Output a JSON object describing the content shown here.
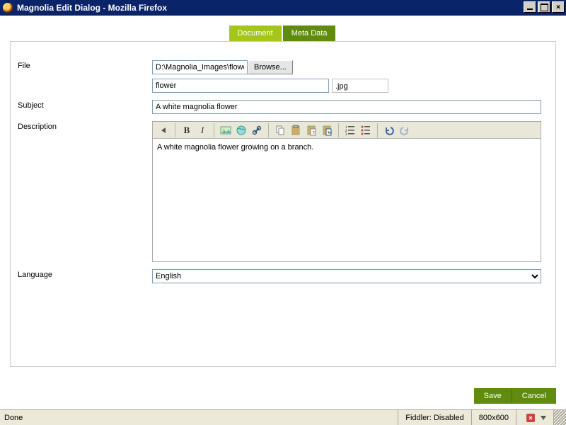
{
  "window": {
    "title": "Magnolia Edit Dialog - Mozilla Firefox"
  },
  "tabs": {
    "document": "Document",
    "metadata": "Meta Data"
  },
  "labels": {
    "file": "File",
    "subject": "Subject",
    "description": "Description",
    "language": "Language"
  },
  "file": {
    "path": "D:\\Magnolia_Images\\flower.jpg",
    "browse": "Browse...",
    "name": "flower",
    "ext": ".jpg"
  },
  "subject": "A white magnolia flower",
  "description": "A white magnolia flower growing on a branch.",
  "language": {
    "selected": "English"
  },
  "actions": {
    "save": "Save",
    "cancel": "Cancel"
  },
  "statusbar": {
    "left": "Done",
    "fiddler": "Fiddler: Disabled",
    "dims": "800x600"
  }
}
